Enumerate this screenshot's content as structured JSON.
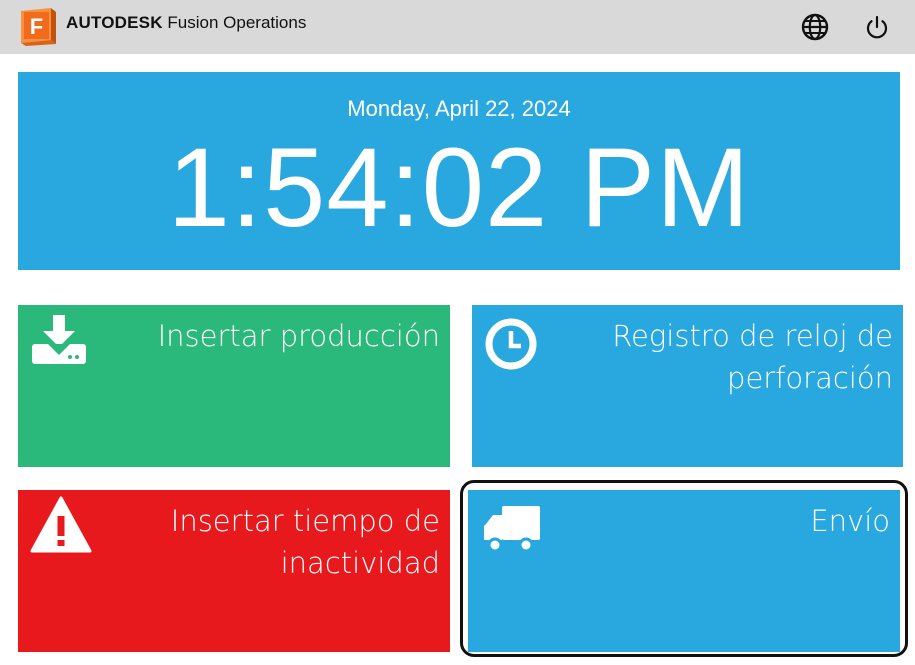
{
  "header": {
    "brand_name": "AUTODESK",
    "product_name": "Fusion Operations",
    "logo_letter": "F",
    "logo_icon": "autodesk-fusion-logo",
    "language_icon": "globe-icon",
    "power_icon": "power-icon"
  },
  "clock": {
    "date": "Monday, April 22, 2024",
    "time": "1:54:02 PM"
  },
  "tiles": [
    {
      "label": "Insertar producción",
      "icon": "download-icon",
      "color": "#2bb97b"
    },
    {
      "label": "Registro de reloj de perforación",
      "icon": "clock-icon",
      "color": "#29a8e0"
    },
    {
      "label": "Insertar tiempo de inactividad",
      "icon": "warning-icon",
      "color": "#e8191c"
    },
    {
      "label": "Envío",
      "icon": "truck-icon",
      "color": "#29a8e0"
    }
  ],
  "colors": {
    "header_bg": "#d9d9d9",
    "accent_blue": "#29a8e0",
    "green": "#2bb97b",
    "red": "#e8191c",
    "logo_orange": "#f26b1d"
  }
}
